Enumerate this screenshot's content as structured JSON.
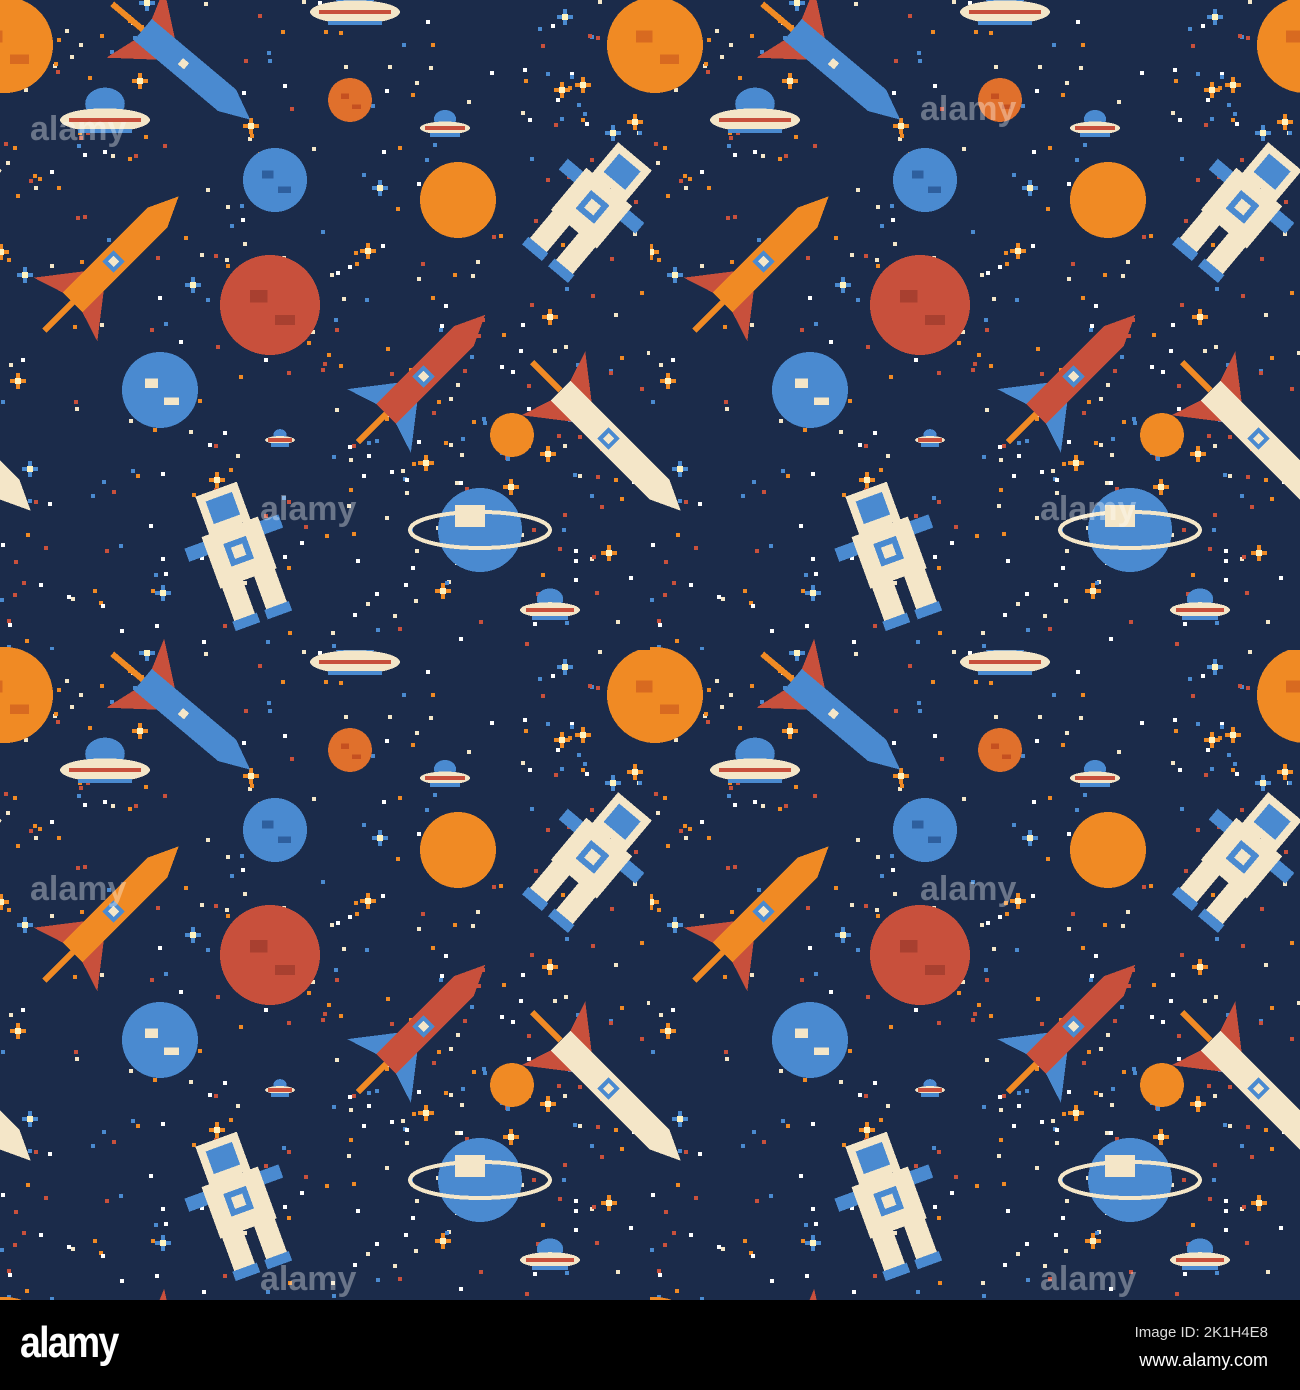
{
  "image": {
    "subject": "pixel-art-space-pattern",
    "colors": {
      "background": "#1b2b4a",
      "orange": "#f08a24",
      "red": "#c8503c",
      "blue": "#4a8ad0",
      "cream": "#f4e6c8",
      "darkblue": "#2e5f9e"
    }
  },
  "watermark": {
    "text": "alamy"
  },
  "footer": {
    "logo": "alamy",
    "image_id": "Image ID: 2K1H4E8",
    "url": "www.alamy.com"
  }
}
